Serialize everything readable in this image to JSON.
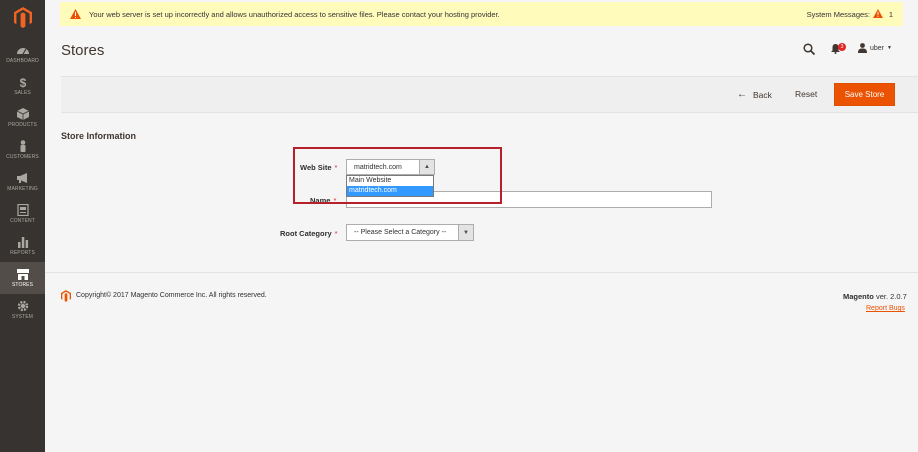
{
  "notice": {
    "message": "Your web server is set up incorrectly and allows unauthorized access to sensitive files. Please contact your hosting provider.",
    "system_messages_label": "System Messages:",
    "system_messages_count": "1"
  },
  "sidebar": {
    "items": [
      {
        "label": "DASHBOARD",
        "icon": "dashboard-icon"
      },
      {
        "label": "SALES",
        "icon": "dollar-icon"
      },
      {
        "label": "PRODUCTS",
        "icon": "box-icon"
      },
      {
        "label": "CUSTOMERS",
        "icon": "person-icon"
      },
      {
        "label": "MARKETING",
        "icon": "megaphone-icon"
      },
      {
        "label": "CONTENT",
        "icon": "content-icon"
      },
      {
        "label": "REPORTS",
        "icon": "bar-chart-icon"
      },
      {
        "label": "STORES",
        "icon": "store-icon"
      },
      {
        "label": "SYSTEM",
        "icon": "gear-icon"
      }
    ],
    "active": "STORES"
  },
  "header": {
    "title": "Stores",
    "notification_count": "3",
    "user": "uber"
  },
  "actions": {
    "back": "Back",
    "reset": "Reset",
    "save": "Save Store"
  },
  "form": {
    "section_title": "Store Information",
    "website_label": "Web Site",
    "website_value": "matridtech.com",
    "website_options": [
      "Main Website",
      "matridtech.com"
    ],
    "website_selected_option": "matridtech.com",
    "name_label": "Name",
    "name_value": "",
    "root_category_label": "Root Category",
    "root_category_value": "-- Please Select a Category --",
    "required_mark": "*"
  },
  "footer": {
    "copyright": "Copyright© 2017 Magento Commerce Inc. All rights reserved.",
    "brand": "Magento",
    "version": "ver. 2.0.7",
    "report_bugs": "Report Bugs"
  },
  "colors": {
    "sidebar_bg": "#373330",
    "accent": "#eb5202",
    "notice_bg": "#fffbbb",
    "highlight_border": "#b5202a",
    "selected_option": "#3399ff"
  }
}
